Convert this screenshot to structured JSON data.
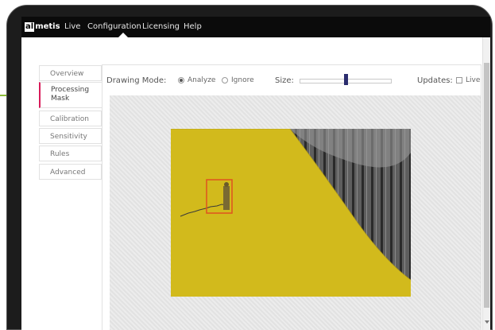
{
  "nav": {
    "logo_box": "al",
    "logo_rest": "metis",
    "items": [
      "Live",
      "Configuration",
      "Licensing",
      "Help"
    ]
  },
  "tabs": {
    "overview": "Overview",
    "mask_line1": "Processing",
    "mask_line2": "Mask",
    "calibration": "Calibration",
    "sensitivity": "Sensitivity",
    "rules": "Rules",
    "advanced": "Advanced"
  },
  "toolbar": {
    "drawing_mode_label": "Drawing Mode:",
    "analyze_label": "Analyze",
    "ignore_label": "Ignore",
    "selected_mode": "Analyze",
    "size_label": "Size:",
    "size_value": 0.5,
    "updates_label": "Updates:",
    "live_label": "Live",
    "live_checked": false
  },
  "colors": {
    "accent_tab": "#d81b5a",
    "annotation": "#8dbd3a",
    "mask_yellow": "#d2ba1c",
    "slider_handle": "#2b2d6e",
    "detection_box": "#e0521f"
  },
  "icons": {
    "radio_analyze": "radio-checked-icon",
    "radio_ignore": "radio-unchecked-icon",
    "live_checkbox": "checkbox-unchecked-icon"
  }
}
